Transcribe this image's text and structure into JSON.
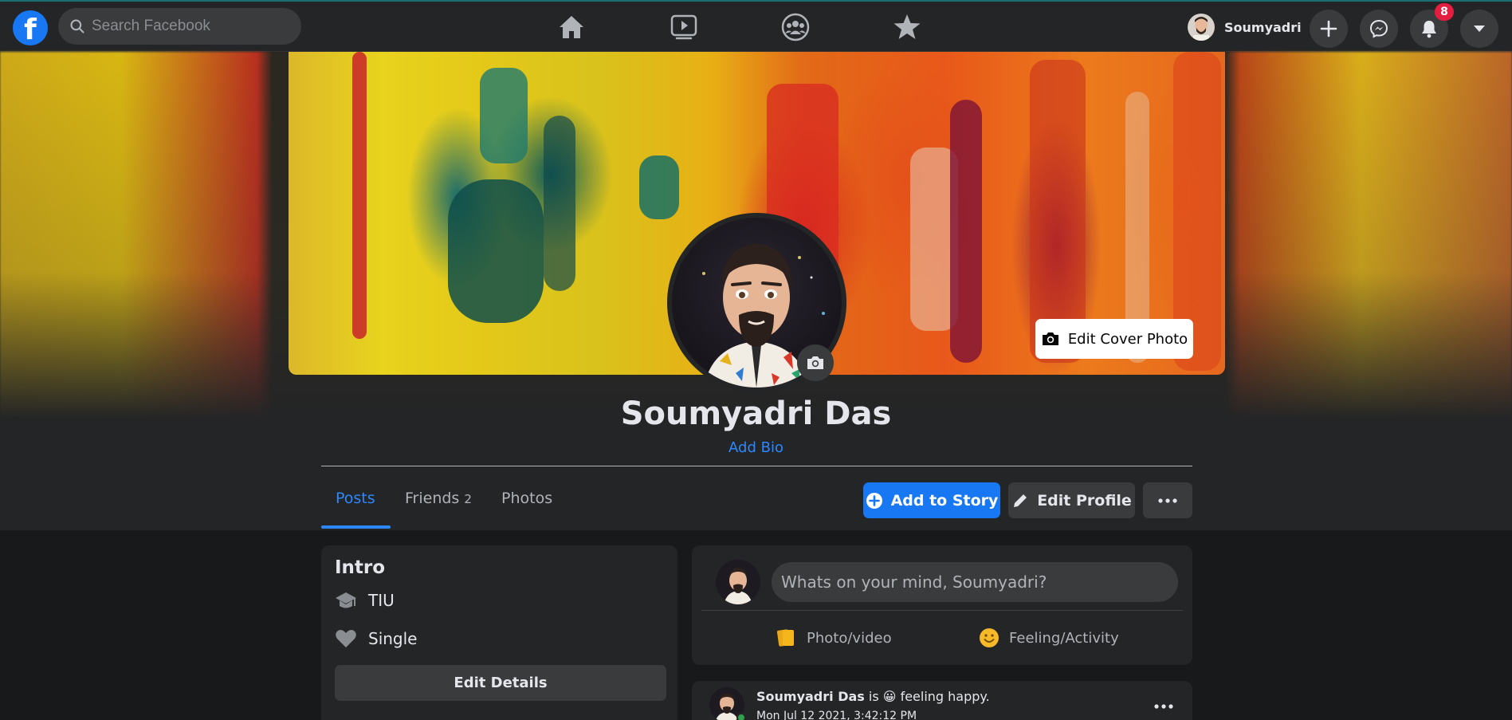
{
  "nav": {
    "logo_letter": "f",
    "search_placeholder": "Search Facebook",
    "user_name": "Soumyadri",
    "notification_count": "8"
  },
  "profile": {
    "edit_cover_label": "Edit Cover Photo",
    "name": "Soumyadri Das",
    "add_bio": "Add Bio"
  },
  "tabs": {
    "posts": "Posts",
    "friends": "Friends",
    "friends_count": "2",
    "photos": "Photos"
  },
  "actions": {
    "add_story": "Add to Story",
    "edit_profile": "Edit Profile"
  },
  "intro": {
    "title": "Intro",
    "education": "TIU",
    "relationship": "Single",
    "edit_details": "Edit Details"
  },
  "composer": {
    "placeholder": "Whats on your mind, Soumyadri?",
    "photo_video": "Photo/video",
    "feeling": "Feeling/Activity"
  },
  "post": {
    "author": "Soumyadri Das",
    "is_text": "is",
    "feeling_emoji": "😀",
    "feeling_text": "feeling happy.",
    "timestamp": "Mon Jul 12 2021, 3:42:12 PM"
  },
  "colors": {
    "accent": "#1877f2",
    "link": "#2d88ff",
    "surface": "#242526",
    "background": "#18191a",
    "badge": "#e41e3f"
  }
}
